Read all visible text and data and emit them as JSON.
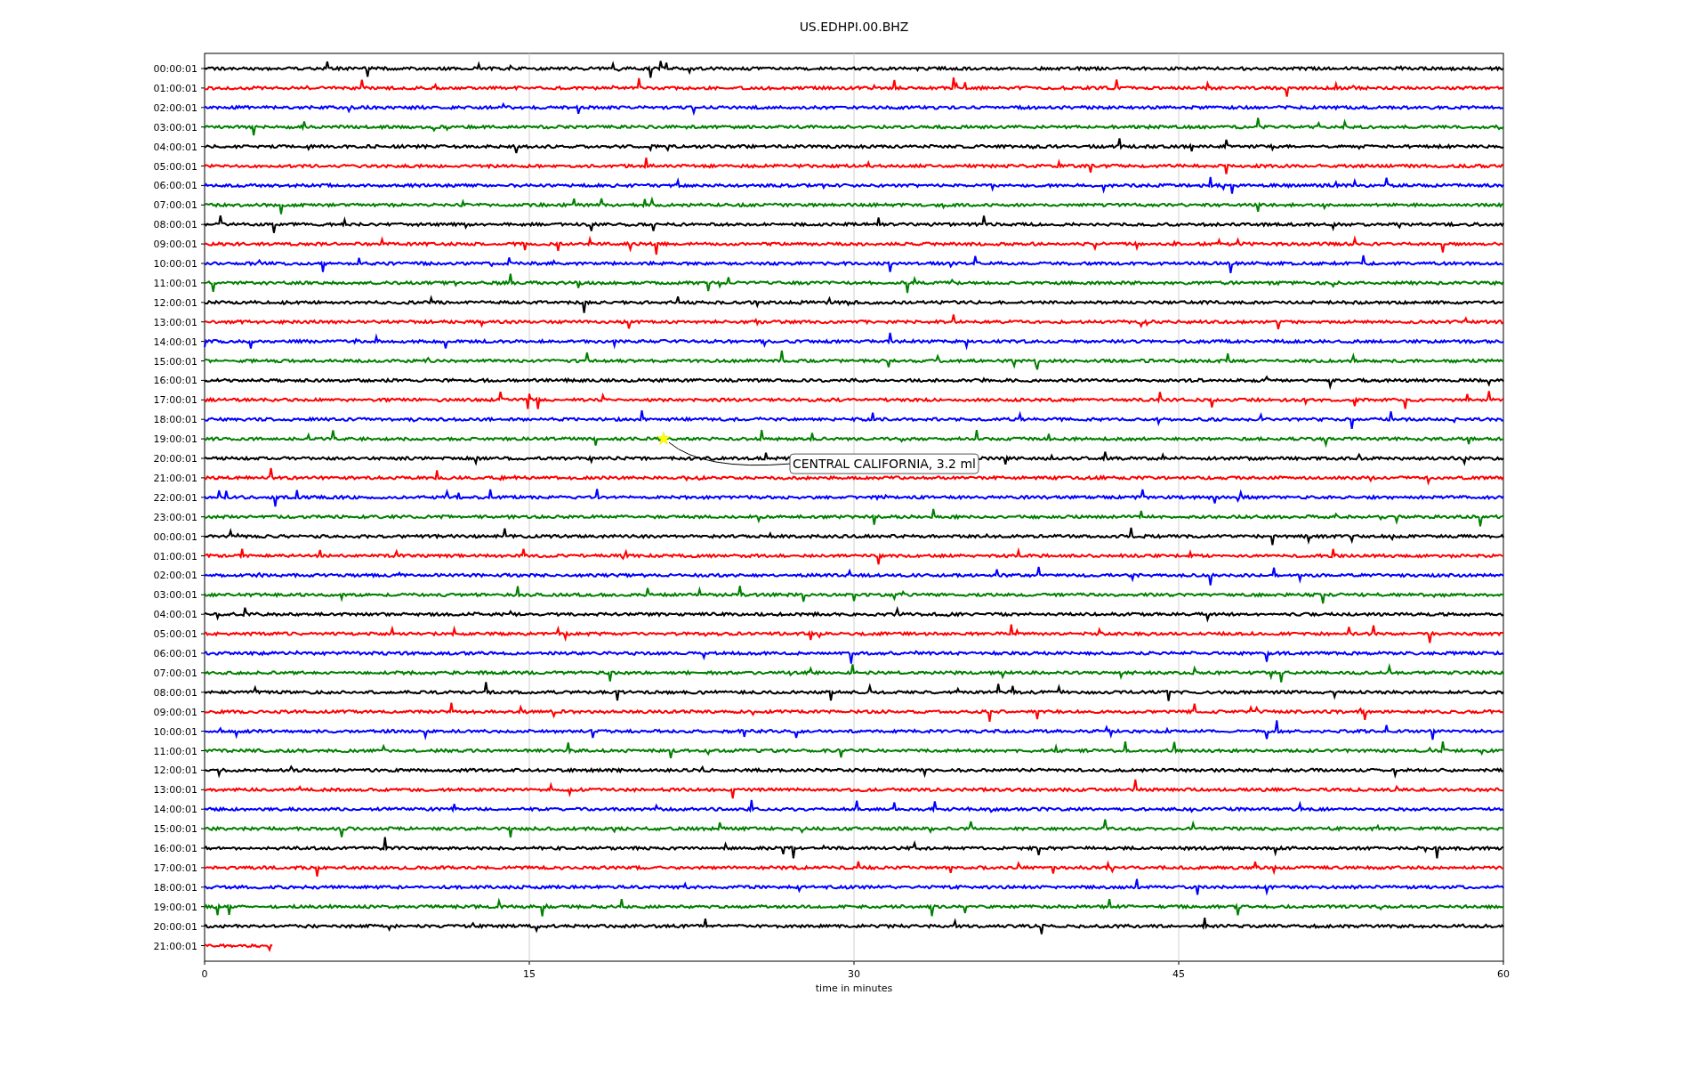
{
  "title": "US.EDHPI.00.BHZ",
  "rows": [
    {
      "label": "00:00:01",
      "color": "#000000",
      "level": 1
    },
    {
      "label": "01:00:01",
      "color": "#ff0000",
      "level": 1
    },
    {
      "label": "02:00:01",
      "color": "#0000ff",
      "level": 1
    },
    {
      "label": "03:00:01",
      "color": "#008000",
      "level": 1
    },
    {
      "label": "04:00:01",
      "color": "#000000",
      "level": 1
    },
    {
      "label": "05:00:01",
      "color": "#ff0000",
      "level": 1
    },
    {
      "label": "06:00:01",
      "color": "#0000ff",
      "level": 1
    },
    {
      "label": "07:00:01",
      "color": "#008000",
      "level": 1
    },
    {
      "label": "08:00:01",
      "color": "#000000",
      "level": 1
    },
    {
      "label": "09:00:01",
      "color": "#ff0000",
      "level": 1
    },
    {
      "label": "10:00:01",
      "color": "#0000ff",
      "level": 1
    },
    {
      "label": "11:00:01",
      "color": "#008000",
      "level": 1
    },
    {
      "label": "12:00:01",
      "color": "#000000",
      "level": 1
    },
    {
      "label": "13:00:01",
      "color": "#ff0000",
      "level": 1
    },
    {
      "label": "14:00:01",
      "color": "#0000ff",
      "level": 1
    },
    {
      "label": "15:00:01",
      "color": "#008000",
      "level": 1
    },
    {
      "label": "16:00:01",
      "color": "#000000",
      "level": 1
    },
    {
      "label": "17:00:01",
      "color": "#ff0000",
      "level": 1
    },
    {
      "label": "18:00:01",
      "color": "#0000ff",
      "level": 1
    },
    {
      "label": "19:00:01",
      "color": "#008000",
      "level": 1,
      "event": "CENTRAL CALIFORNIA, 3.2 ml"
    },
    {
      "label": "20:00:01",
      "color": "#000000",
      "level": 1
    },
    {
      "label": "21:00:01",
      "color": "#ff0000",
      "level": 1
    },
    {
      "label": "22:00:01",
      "color": "#0000ff",
      "level": 1
    },
    {
      "label": "23:00:01",
      "color": "#008000",
      "level": 1
    },
    {
      "label": "00:00:01",
      "color": "#000000",
      "level": 1
    },
    {
      "label": "01:00:01",
      "color": "#ff0000",
      "level": 1
    },
    {
      "label": "02:00:01",
      "color": "#0000ff",
      "level": 1
    },
    {
      "label": "03:00:01",
      "color": "#008000",
      "level": 1
    },
    {
      "label": "04:00:01",
      "color": "#000000",
      "level": 1
    },
    {
      "label": "05:00:01",
      "color": "#ff0000",
      "level": 1
    },
    {
      "label": "06:00:01",
      "color": "#0000ff",
      "level": 1
    },
    {
      "label": "07:00:01",
      "color": "#008000",
      "level": 1
    },
    {
      "label": "08:00:01",
      "color": "#000000",
      "level": 1
    },
    {
      "label": "09:00:01",
      "color": "#ff0000",
      "level": 1
    },
    {
      "label": "10:00:01",
      "color": "#0000ff",
      "level": 1
    },
    {
      "label": "11:00:01",
      "color": "#008000",
      "level": 1
    },
    {
      "label": "12:00:01",
      "color": "#000000",
      "level": 1
    },
    {
      "label": "13:00:01",
      "color": "#ff0000",
      "level": 1
    },
    {
      "label": "14:00:01",
      "color": "#0000ff",
      "level": 1
    },
    {
      "label": "15:00:01",
      "color": "#008000",
      "level": 1
    },
    {
      "label": "16:00:01",
      "color": "#000000",
      "level": 1
    },
    {
      "label": "17:00:01",
      "color": "#ff0000",
      "level": 1
    },
    {
      "label": "18:00:01",
      "color": "#0000ff",
      "level": 1
    },
    {
      "label": "19:00:01",
      "color": "#008000",
      "level": 1
    },
    {
      "label": "20:00:01",
      "color": "#000000",
      "level": 1
    },
    {
      "label": "21:00:01",
      "color": "#ff0000",
      "level": 0.052
    }
  ],
  "x_axis": {
    "ticks": [
      "0",
      "15",
      "30",
      "45",
      "60"
    ],
    "label": "time in minutes"
  }
}
